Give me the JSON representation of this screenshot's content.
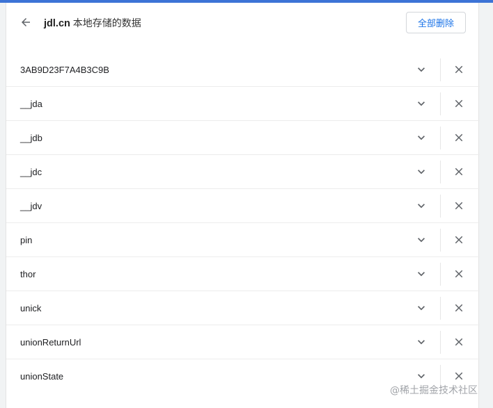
{
  "header": {
    "domain": "jdl.cn",
    "subtitle": "本地存储的数据",
    "delete_all_label": "全部删除",
    "back_icon": "arrow-left-icon"
  },
  "items": [
    {
      "name": "3AB9D23F7A4B3C9B"
    },
    {
      "name": "__jda"
    },
    {
      "name": "__jdb"
    },
    {
      "name": "__jdc"
    },
    {
      "name": "__jdv"
    },
    {
      "name": "pin"
    },
    {
      "name": "thor"
    },
    {
      "name": "unick"
    },
    {
      "name": "unionReturnUrl"
    },
    {
      "name": "unionState"
    }
  ],
  "icons": {
    "expand": "chevron-down-icon",
    "remove": "close-icon"
  },
  "watermark": "@稀土掘金技术社区",
  "colors": {
    "accent_bar": "#3c73d6",
    "button_text": "#1a73e8",
    "icon": "#5f6368"
  }
}
